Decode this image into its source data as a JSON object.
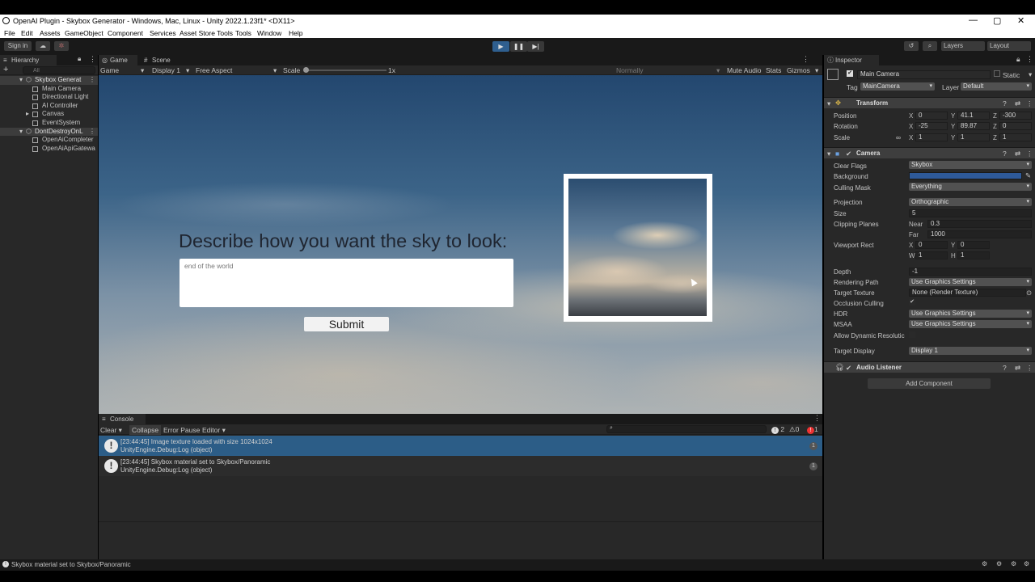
{
  "window": {
    "title": "OpenAI Plugin - Skybox Generator - Windows, Mac, Linux - Unity 2022.1.23f1* <DX11>",
    "controls": [
      "—",
      "▢",
      "✕"
    ]
  },
  "menu": [
    "File",
    "Edit",
    "Assets",
    "GameObject",
    "Component",
    "Services",
    "Asset Store Tools",
    "Tools",
    "Window",
    "Help"
  ],
  "toolbar": {
    "sign_in": "Sign in",
    "layers": "Layers",
    "layout": "Layout",
    "play_icon": "▶",
    "pause_icon": "❚❚",
    "step_icon": "▶|"
  },
  "hierarchy": {
    "tab": "Hierarchy",
    "search_placeholder": "All",
    "add_icon": "+",
    "items": [
      {
        "label": "Skybox Generat",
        "scene": true
      },
      {
        "label": "Main Camera"
      },
      {
        "label": "Directional Light"
      },
      {
        "label": "AI Controller"
      },
      {
        "label": "Canvas",
        "expandable": true
      },
      {
        "label": "EventSystem"
      },
      {
        "label": "DontDestroyOnL",
        "scene": true
      },
      {
        "label": "OpenAiCompleter"
      },
      {
        "label": "OpenAiApiGatewa"
      }
    ]
  },
  "game": {
    "tabs": [
      "Game",
      "Scene"
    ],
    "mode": "Game",
    "display": "Display 1",
    "aspect": "Free Aspect",
    "scale_label": "Scale",
    "scale_value": "1x",
    "normally": "Normally",
    "mute_audio": "Mute Audio",
    "stats": "Stats",
    "gizmos": "Gizmos",
    "prompt_label": "Describe how you want the sky to look:",
    "input_value": "end of the world",
    "submit_label": "Submit"
  },
  "console": {
    "tab": "Console",
    "clear": "Clear",
    "collapse": "Collapse",
    "error_pause": "Error Pause",
    "editor": "Editor",
    "count_info": "2",
    "count_warn": "0",
    "count_error": "1",
    "entries": [
      {
        "line1": "[23:44:45] Image texture loaded with size 1024x1024",
        "line2": "UnityEngine.Debug:Log (object)",
        "count": "1",
        "selected": true
      },
      {
        "line1": "[23:44:45] Skybox material set to Skybox/Panoramic",
        "line2": "UnityEngine.Debug:Log (object)",
        "count": "1",
        "selected": false
      }
    ]
  },
  "inspector": {
    "tab": "Inspector",
    "object_name": "Main Camera",
    "static": "Static",
    "tag_label": "Tag",
    "tag": "MainCamera",
    "layer_label": "Layer",
    "layer": "Default",
    "transform": {
      "title": "Transform",
      "position_label": "Position",
      "position": [
        "0",
        "41.1",
        "-300"
      ],
      "rotation_label": "Rotation",
      "rotation": [
        "-25",
        "89.87",
        "0"
      ],
      "scale_label": "Scale",
      "scale": [
        "1",
        "1",
        "1"
      ]
    },
    "camera": {
      "title": "Camera",
      "clear_flags_label": "Clear Flags",
      "clear_flags": "Skybox",
      "background_label": "Background",
      "background_color": "#2e5a9a",
      "culling_mask_label": "Culling Mask",
      "culling_mask": "Everything",
      "projection_label": "Projection",
      "projection": "Orthographic",
      "size_label": "Size",
      "size": "5",
      "clipping_label": "Clipping Planes",
      "near_label": "Near",
      "near": "0.3",
      "far_label": "Far",
      "far": "1000",
      "viewport_label": "Viewport Rect",
      "vp_x": "0",
      "vp_y": "0",
      "vp_w": "1",
      "vp_h": "1",
      "depth_label": "Depth",
      "depth": "-1",
      "rendering_path_label": "Rendering Path",
      "rendering_path": "Use Graphics Settings",
      "target_texture_label": "Target Texture",
      "target_texture": "None (Render Texture)",
      "occlusion_label": "Occlusion Culling",
      "hdr_label": "HDR",
      "hdr": "Use Graphics Settings",
      "msaa_label": "MSAA",
      "msaa": "Use Graphics Settings",
      "dynamic_res_label": "Allow Dynamic Resolutic",
      "target_display_label": "Target Display",
      "target_display": "Display 1"
    },
    "audio_listener": "Audio Listener",
    "add_component": "Add Component"
  },
  "status": {
    "message": "Skybox material set to Skybox/Panoramic"
  }
}
